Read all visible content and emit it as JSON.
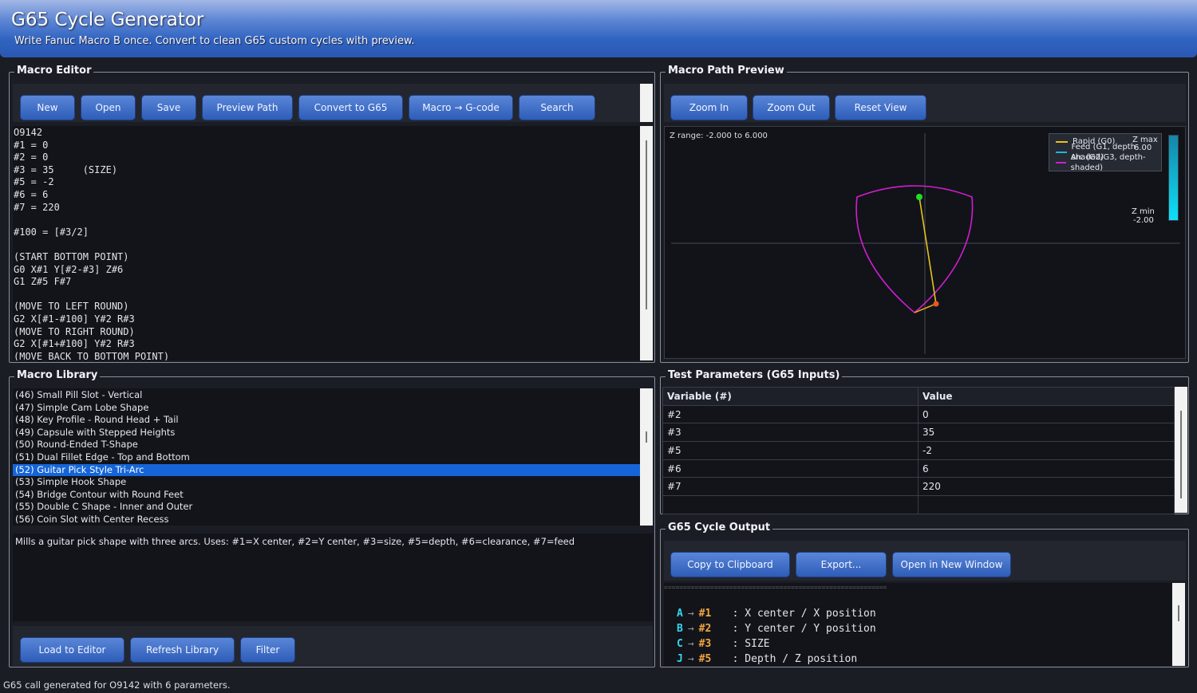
{
  "header": {
    "title": "G65 Cycle Generator",
    "subtitle": "Write Fanuc Macro B once. Convert to clean G65 custom cycles with preview."
  },
  "editor": {
    "title": "Macro Editor",
    "buttons": [
      "New",
      "Open",
      "Save",
      "Preview Path",
      "Convert to G65",
      "Macro → G-code",
      "Search"
    ],
    "lines": [
      "O9142",
      "#1 = 0",
      "#2 = 0",
      "#3 = 35     (SIZE)",
      "#5 = -2",
      "#6 = 6",
      "#7 = 220",
      "",
      "#100 = [#3/2]",
      "",
      "(START BOTTOM POINT)",
      "G0 X#1 Y[#2-#3] Z#6",
      "G1 Z#5 F#7",
      "",
      "(MOVE TO LEFT ROUND)",
      "G2 X[#1-#100] Y#2 R#3",
      "(MOVE TO RIGHT ROUND)",
      "G2 X[#1+#100] Y#2 R#3",
      "(MOVE BACK TO BOTTOM POINT)"
    ]
  },
  "preview": {
    "title": "Macro Path Preview",
    "buttons": [
      "Zoom In",
      "Zoom Out",
      "Reset View"
    ],
    "z_range": "Z range: -2.000 to 6.000",
    "legend": [
      {
        "label": "Rapid (G0)",
        "color": "#e8c21a"
      },
      {
        "label": "Feed (G1, depth-shaded)",
        "color": "#1fb4e0"
      },
      {
        "label": "Arc (G2/G3, depth-shaded)",
        "color": "#d21ccf"
      }
    ],
    "zmax_label": "Z max",
    "zmax": "6.00",
    "zmin_label": "Z min",
    "zmin": "-2.00"
  },
  "library": {
    "title": "Macro Library",
    "items": [
      "(46) Small Pill Slot - Vertical",
      "(47) Simple Cam Lobe Shape",
      "(48) Key Profile - Round Head + Tail",
      "(49) Capsule with Stepped Heights",
      "(50) Round-Ended T-Shape",
      "(51) Dual Fillet Edge - Top and Bottom",
      "(52) Guitar Pick Style Tri-Arc",
      "(53) Simple Hook Shape",
      "(54) Bridge Contour with Round Feet",
      "(55) Double C Shape - Inner and Outer",
      "(56) Coin Slot with Center Recess"
    ],
    "selected_index": 6,
    "description": "Mills a guitar pick shape with three arcs. Uses: #1=X center, #2=Y center, #3=size, #5=depth, #6=clearance, #7=feed",
    "buttons": [
      "Load to Editor",
      "Refresh Library",
      "Filter"
    ]
  },
  "params": {
    "title": "Test Parameters (G65 Inputs)",
    "headers": [
      "Variable (#)",
      "Value"
    ],
    "rows": [
      [
        "#2",
        "0"
      ],
      [
        "#3",
        "35"
      ],
      [
        "#5",
        "-2"
      ],
      [
        "#6",
        "6"
      ],
      [
        "#7",
        "220"
      ],
      [
        "",
        ""
      ]
    ]
  },
  "output": {
    "title": "G65 Cycle Output",
    "buttons": [
      "Copy to Clipboard",
      "Export...",
      "Open in New Window"
    ],
    "separator": "==========================================================",
    "rows": [
      {
        "letter": "A",
        "var": "#1",
        "desc": ": X center / X position"
      },
      {
        "letter": "B",
        "var": "#2",
        "desc": ": Y center / Y position"
      },
      {
        "letter": "C",
        "var": "#3",
        "desc": ": SIZE"
      },
      {
        "letter": "J",
        "var": "#5",
        "desc": ": Depth / Z position"
      }
    ],
    "arrow": "→"
  },
  "status": "G65 call generated for O9142 with 6 parameters."
}
